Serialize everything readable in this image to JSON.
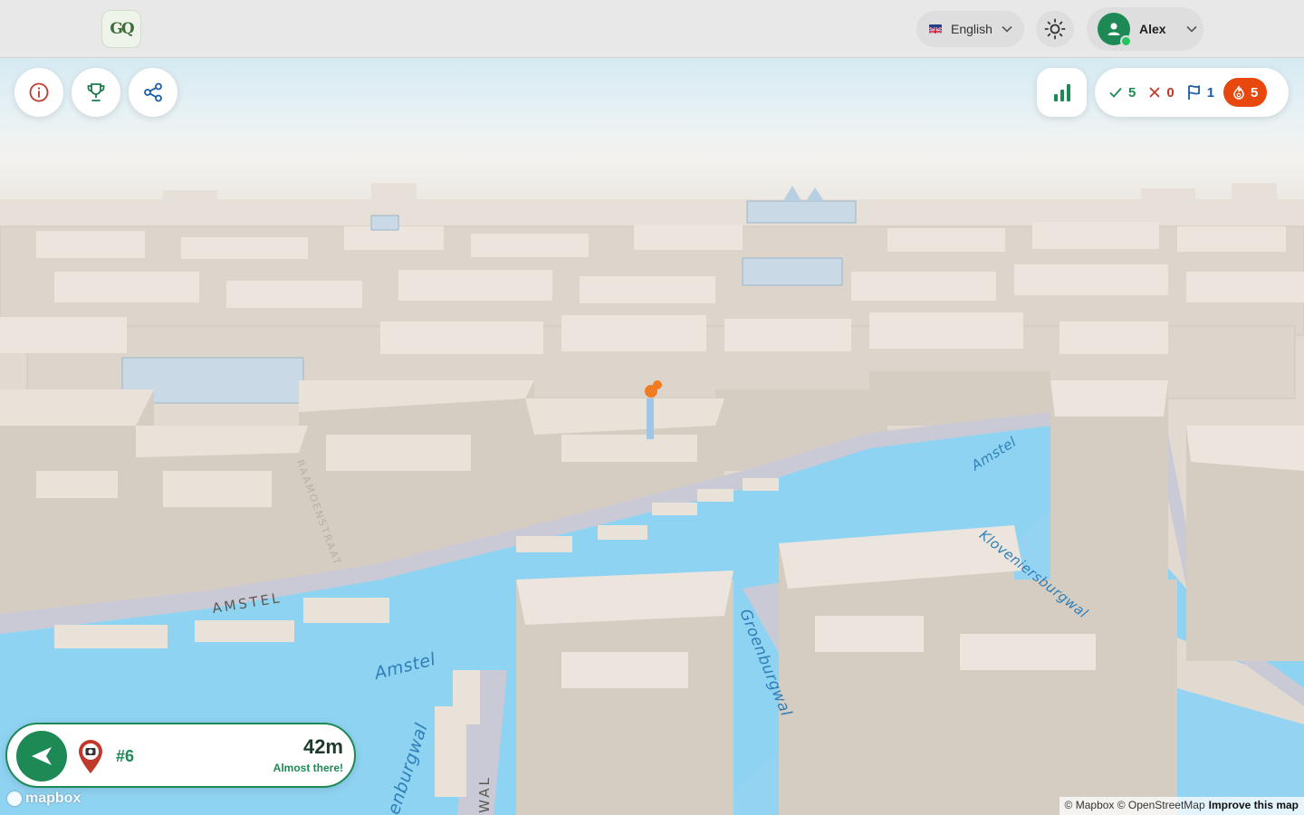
{
  "app": {
    "logo_text": "GQ"
  },
  "header": {
    "language": {
      "flag": "uk-flag-icon",
      "label": "English"
    },
    "theme_toggle": {
      "icon": "sun-icon"
    },
    "user": {
      "name": "Alex",
      "status": "online"
    }
  },
  "toolbar_left": [
    {
      "name": "info-button",
      "icon": "info-icon"
    },
    {
      "name": "leaderboard-button",
      "icon": "trophy-icon"
    },
    {
      "name": "share-button",
      "icon": "share-icon"
    }
  ],
  "score": {
    "correct": "5",
    "wrong": "0",
    "flags": "1",
    "streak": "5",
    "colors": {
      "correct": "#1d8a55",
      "wrong": "#c0392b",
      "flags": "#1b5ca8",
      "streak": "#e8480d"
    }
  },
  "distance_card": {
    "target_label": "#6",
    "distance": "42m",
    "message": "Almost there!"
  },
  "map": {
    "labels": {
      "amstel_upper": "Amstel",
      "amstel_lower": "Amstel",
      "street_amstel": "AMSTEL",
      "kloveniersburgwal": "Kloveniersburgwal",
      "groenburgwal": "Groenburgwal",
      "faint_street": "RAAMOENSTRAAT",
      "bottom_canal": "enburgwal",
      "bottom_street": "WAL"
    },
    "branding": "mapbox",
    "attribution": "© Mapbox © OpenStreetMap",
    "improve_link": "Improve this map",
    "colors": {
      "water": "#8fd3f2",
      "building_top": "#ece6de",
      "building_side": "#d8d0c6",
      "road": "#c9c9d4"
    }
  }
}
